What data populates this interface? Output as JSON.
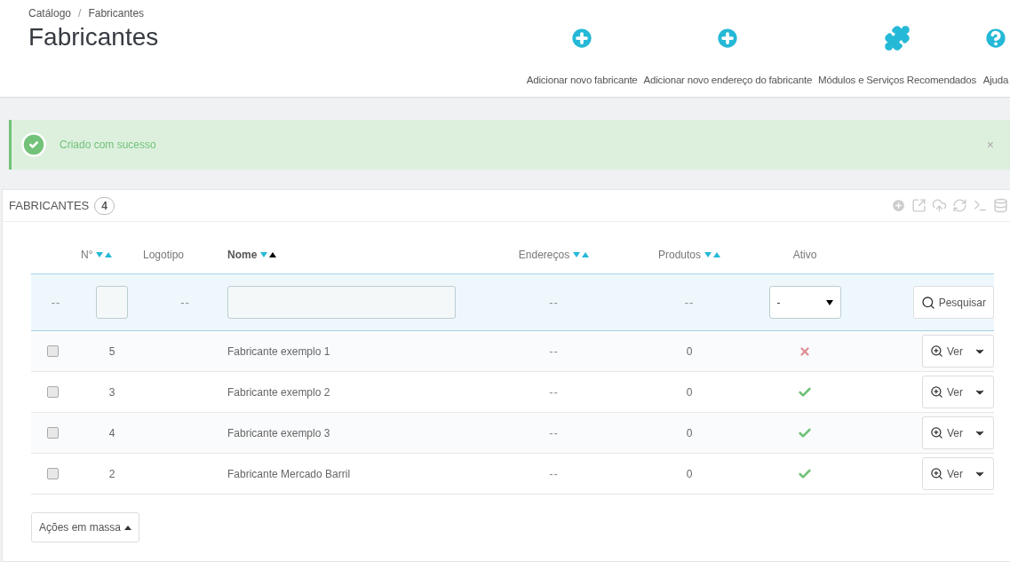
{
  "breadcrumb": [
    "Catálogo",
    "Fabricantes"
  ],
  "breadcrumb_separator": "/",
  "page_title": "Fabricantes",
  "toolbar": [
    {
      "kind": "add",
      "label": "Adicionar novo fabricante"
    },
    {
      "kind": "add",
      "label": "Adicionar novo endereço do fabricante"
    },
    {
      "kind": "modules",
      "label": "Módulos e Serviços Recomendados"
    },
    {
      "kind": "help",
      "label": "Ajuda"
    }
  ],
  "alert": {
    "message": "Criado com sucesso",
    "close": "×"
  },
  "panel": {
    "title": "FABRICANTES",
    "count": "4"
  },
  "table": {
    "columns": [
      {
        "label": "N°",
        "sortable": true,
        "sorted_ascending": false
      },
      {
        "label": "Logotipo",
        "sortable": false,
        "sorted_ascending": false
      },
      {
        "label": "Nome",
        "sortable": true,
        "sorted_ascending": true
      },
      {
        "label": "Endereços",
        "sortable": true,
        "sorted_ascending": false
      },
      {
        "label": "Produtos",
        "sortable": true,
        "sorted_ascending": false
      },
      {
        "label": "Ativo",
        "sortable": false,
        "sorted_ascending": false
      }
    ],
    "filters": {
      "select_all": "--",
      "logo": "--",
      "addresses": "--",
      "products": "--",
      "active_value": "-",
      "search_button": "Pesquisar"
    },
    "rows": [
      {
        "checked": false,
        "id": "5",
        "name": "Fabricante exemplo 1",
        "addresses": "--",
        "products": "0",
        "active": false,
        "action": "Ver"
      },
      {
        "checked": false,
        "id": "3",
        "name": "Fabricante exemplo 2",
        "addresses": "--",
        "products": "0",
        "active": true,
        "action": "Ver"
      },
      {
        "checked": false,
        "id": "4",
        "name": "Fabricante exemplo 3",
        "addresses": "--",
        "products": "0",
        "active": true,
        "action": "Ver"
      },
      {
        "checked": false,
        "id": "2",
        "name": "Fabricante Mercado Barril",
        "addresses": "--",
        "products": "0",
        "active": true,
        "action": "Ver"
      }
    ]
  },
  "bulk_actions": "Ações em massa"
}
